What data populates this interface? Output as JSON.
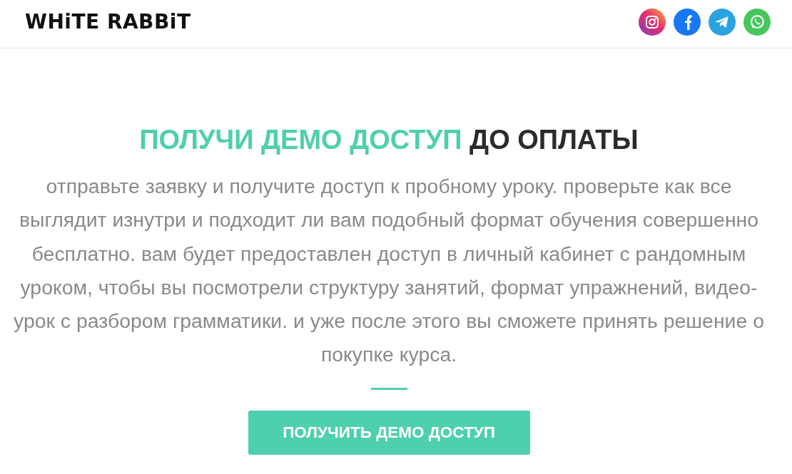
{
  "header": {
    "logo": "WHiTE RABBiT",
    "social_links": [
      {
        "kind": "instagram"
      },
      {
        "kind": "facebook"
      },
      {
        "kind": "telegram"
      },
      {
        "kind": "whatsapp"
      }
    ]
  },
  "promo": {
    "heading_highlight": "ПОЛУЧИ ДЕМО ДОСТУП",
    "heading_rest": "ДО ОПЛАТЫ",
    "description": "отправьте заявку и получите доступ к пробному уроку. проверьте как все выглядит изнутри и подходит ли вам подобный формат обучения совершенно бесплатно. вам будет предоставлен доступ в личный кабинет с рандомным уроком, чтобы вы посмотрели структуру занятий, формат упражнений, видео-урок с разбором грамматики. и уже после этого вы сможете принять решение о покупке курса.",
    "button": "ПОЛУЧИТЬ ДЕМО ДОСТУП"
  }
}
